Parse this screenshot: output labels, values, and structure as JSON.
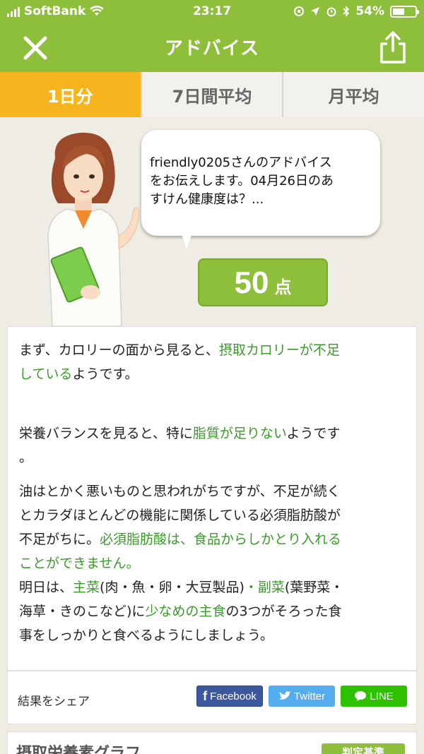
{
  "status_bar": {
    "carrier": "SoftBank",
    "time": "23:17",
    "battery": "54%",
    "battery_level": 0.54
  },
  "header": {
    "title": "アドバイス"
  },
  "tabs": [
    {
      "label": "1日分",
      "active": true
    },
    {
      "label": "7日間平均",
      "active": false
    },
    {
      "label": "月平均",
      "active": false
    }
  ],
  "advisor": {
    "line1": "friendly0205さんのアドバイス",
    "line2": "をお伝えします。04月26日のあ",
    "line3": "すけん健康度は？...",
    "score": "50",
    "score_unit": "点"
  },
  "advice": {
    "p1_a": "まず、カロリーの面から見ると、",
    "p1_b": "摂取カロリーが不足",
    "p1_c": "している",
    "p1_d": "ようです。",
    "p2_a": "栄養バランスを見ると、特に",
    "p2_b": "脂質が足りない",
    "p2_c": "ようです",
    "p2_d": "。",
    "p3_a": "油はとかく悪いものと思われがちですが、不足が続く",
    "p3_b": "とカラダほとんどの機能に関係している必須脂肪酸が",
    "p3_c": "不足がちに。",
    "p3_d": "必須脂肪酸は、食品からしかとり入れる",
    "p3_e": "ことができません。",
    "p4_a": "明日は、",
    "p4_b": "主菜",
    "p4_c": "(肉・魚・卵・大豆製品)",
    "p4_d": "・副菜",
    "p4_e": "(葉野菜・",
    "p4_f": "海草・きのこなど)に",
    "p4_g": "少なめの主食",
    "p4_h": "の3つがそろった食",
    "p4_i": "事をしっかりと食べるようにしましょう。"
  },
  "share": {
    "label": "結果をシェア",
    "facebook": "Facebook",
    "twitter": "Twitter",
    "line": "LINE"
  },
  "bottom": {
    "title": "摂取栄養素グラフ",
    "button": "判定基準"
  },
  "colors": {
    "brand_green": "#8dbf3b",
    "tab_active": "#f6b51e",
    "highlight_green": "#3a9b2a",
    "facebook": "#3b579d",
    "twitter": "#55acee",
    "line": "#2ec100"
  },
  "icons": {
    "close": "close-icon",
    "share": "share-icon",
    "wifi": "wifi-icon",
    "bluetooth": "bluetooth-icon",
    "alarm": "alarm-icon",
    "location": "location-icon"
  }
}
